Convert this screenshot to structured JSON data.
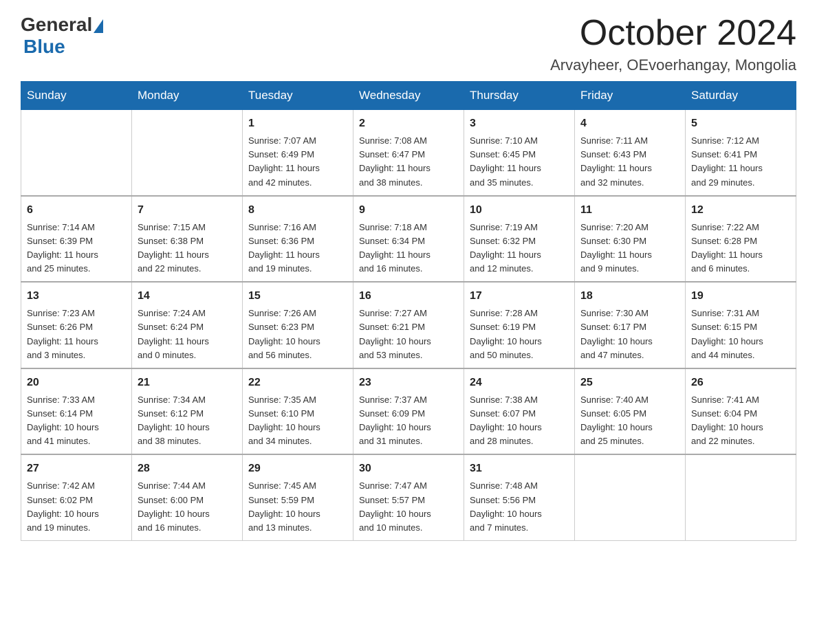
{
  "header": {
    "logo": {
      "general": "General",
      "blue": "Blue"
    },
    "title": "October 2024",
    "subtitle": "Arvayheer, OEvoerhangay, Mongolia"
  },
  "weekdays": [
    "Sunday",
    "Monday",
    "Tuesday",
    "Wednesday",
    "Thursday",
    "Friday",
    "Saturday"
  ],
  "weeks": [
    [
      {
        "day": "",
        "info": ""
      },
      {
        "day": "",
        "info": ""
      },
      {
        "day": "1",
        "info": "Sunrise: 7:07 AM\nSunset: 6:49 PM\nDaylight: 11 hours\nand 42 minutes."
      },
      {
        "day": "2",
        "info": "Sunrise: 7:08 AM\nSunset: 6:47 PM\nDaylight: 11 hours\nand 38 minutes."
      },
      {
        "day": "3",
        "info": "Sunrise: 7:10 AM\nSunset: 6:45 PM\nDaylight: 11 hours\nand 35 minutes."
      },
      {
        "day": "4",
        "info": "Sunrise: 7:11 AM\nSunset: 6:43 PM\nDaylight: 11 hours\nand 32 minutes."
      },
      {
        "day": "5",
        "info": "Sunrise: 7:12 AM\nSunset: 6:41 PM\nDaylight: 11 hours\nand 29 minutes."
      }
    ],
    [
      {
        "day": "6",
        "info": "Sunrise: 7:14 AM\nSunset: 6:39 PM\nDaylight: 11 hours\nand 25 minutes."
      },
      {
        "day": "7",
        "info": "Sunrise: 7:15 AM\nSunset: 6:38 PM\nDaylight: 11 hours\nand 22 minutes."
      },
      {
        "day": "8",
        "info": "Sunrise: 7:16 AM\nSunset: 6:36 PM\nDaylight: 11 hours\nand 19 minutes."
      },
      {
        "day": "9",
        "info": "Sunrise: 7:18 AM\nSunset: 6:34 PM\nDaylight: 11 hours\nand 16 minutes."
      },
      {
        "day": "10",
        "info": "Sunrise: 7:19 AM\nSunset: 6:32 PM\nDaylight: 11 hours\nand 12 minutes."
      },
      {
        "day": "11",
        "info": "Sunrise: 7:20 AM\nSunset: 6:30 PM\nDaylight: 11 hours\nand 9 minutes."
      },
      {
        "day": "12",
        "info": "Sunrise: 7:22 AM\nSunset: 6:28 PM\nDaylight: 11 hours\nand 6 minutes."
      }
    ],
    [
      {
        "day": "13",
        "info": "Sunrise: 7:23 AM\nSunset: 6:26 PM\nDaylight: 11 hours\nand 3 minutes."
      },
      {
        "day": "14",
        "info": "Sunrise: 7:24 AM\nSunset: 6:24 PM\nDaylight: 11 hours\nand 0 minutes."
      },
      {
        "day": "15",
        "info": "Sunrise: 7:26 AM\nSunset: 6:23 PM\nDaylight: 10 hours\nand 56 minutes."
      },
      {
        "day": "16",
        "info": "Sunrise: 7:27 AM\nSunset: 6:21 PM\nDaylight: 10 hours\nand 53 minutes."
      },
      {
        "day": "17",
        "info": "Sunrise: 7:28 AM\nSunset: 6:19 PM\nDaylight: 10 hours\nand 50 minutes."
      },
      {
        "day": "18",
        "info": "Sunrise: 7:30 AM\nSunset: 6:17 PM\nDaylight: 10 hours\nand 47 minutes."
      },
      {
        "day": "19",
        "info": "Sunrise: 7:31 AM\nSunset: 6:15 PM\nDaylight: 10 hours\nand 44 minutes."
      }
    ],
    [
      {
        "day": "20",
        "info": "Sunrise: 7:33 AM\nSunset: 6:14 PM\nDaylight: 10 hours\nand 41 minutes."
      },
      {
        "day": "21",
        "info": "Sunrise: 7:34 AM\nSunset: 6:12 PM\nDaylight: 10 hours\nand 38 minutes."
      },
      {
        "day": "22",
        "info": "Sunrise: 7:35 AM\nSunset: 6:10 PM\nDaylight: 10 hours\nand 34 minutes."
      },
      {
        "day": "23",
        "info": "Sunrise: 7:37 AM\nSunset: 6:09 PM\nDaylight: 10 hours\nand 31 minutes."
      },
      {
        "day": "24",
        "info": "Sunrise: 7:38 AM\nSunset: 6:07 PM\nDaylight: 10 hours\nand 28 minutes."
      },
      {
        "day": "25",
        "info": "Sunrise: 7:40 AM\nSunset: 6:05 PM\nDaylight: 10 hours\nand 25 minutes."
      },
      {
        "day": "26",
        "info": "Sunrise: 7:41 AM\nSunset: 6:04 PM\nDaylight: 10 hours\nand 22 minutes."
      }
    ],
    [
      {
        "day": "27",
        "info": "Sunrise: 7:42 AM\nSunset: 6:02 PM\nDaylight: 10 hours\nand 19 minutes."
      },
      {
        "day": "28",
        "info": "Sunrise: 7:44 AM\nSunset: 6:00 PM\nDaylight: 10 hours\nand 16 minutes."
      },
      {
        "day": "29",
        "info": "Sunrise: 7:45 AM\nSunset: 5:59 PM\nDaylight: 10 hours\nand 13 minutes."
      },
      {
        "day": "30",
        "info": "Sunrise: 7:47 AM\nSunset: 5:57 PM\nDaylight: 10 hours\nand 10 minutes."
      },
      {
        "day": "31",
        "info": "Sunrise: 7:48 AM\nSunset: 5:56 PM\nDaylight: 10 hours\nand 7 minutes."
      },
      {
        "day": "",
        "info": ""
      },
      {
        "day": "",
        "info": ""
      }
    ]
  ]
}
